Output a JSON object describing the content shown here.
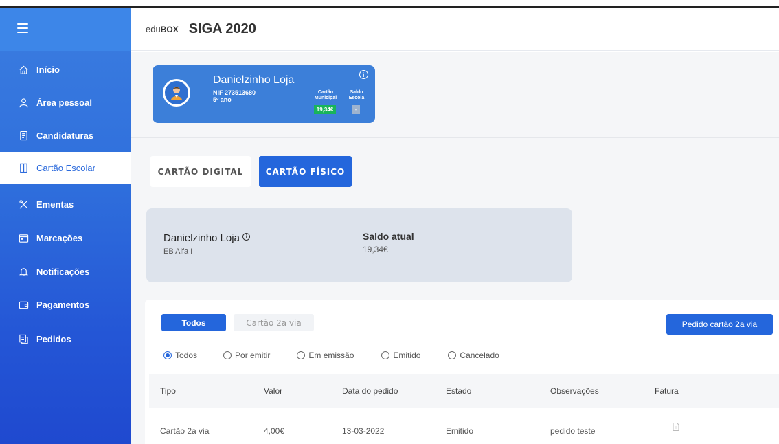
{
  "header": {
    "logo_text": "edu",
    "logo_box": "BOX",
    "title": "SIGA 2020"
  },
  "sidebar": {
    "items": [
      {
        "label": "Início",
        "icon": "home-icon"
      },
      {
        "label": "Área pessoal",
        "icon": "user-icon"
      },
      {
        "label": "Candidaturas",
        "icon": "document-icon"
      },
      {
        "label": "Cartão Escolar",
        "icon": "card-icon",
        "active": true
      },
      {
        "label": "Ementas",
        "icon": "cutlery-icon"
      },
      {
        "label": "Marcações",
        "icon": "calendar-icon"
      },
      {
        "label": "Notificações",
        "icon": "bell-icon"
      },
      {
        "label": "Pagamentos",
        "icon": "wallet-icon"
      },
      {
        "label": "Pedidos",
        "icon": "receipt-icon"
      }
    ]
  },
  "student": {
    "name": "Danielzinho Loja",
    "nif": "NIF 273513680",
    "year": "5º ano",
    "info": "i",
    "col1_label": "Cartão Municipal",
    "col2_label": "Saldo Escola",
    "municipal_balance": "19,34€",
    "school_balance": "-"
  },
  "tabs": {
    "digital": "CARTÃO DIGITAL",
    "fisico": "CARTÃO FÍSICO"
  },
  "balance": {
    "name": "Danielzinho Loja",
    "school": "EB Alfa I",
    "label": "Saldo atual",
    "value": "19,34€"
  },
  "requests": {
    "filter_all": "Todos",
    "filter_2via": "Cartão 2a via",
    "new_button": "Pedido cartão 2a via",
    "radios": [
      "Todos",
      "Por emitir",
      "Em emissão",
      "Emitido",
      "Cancelado"
    ],
    "columns": [
      "Tipo",
      "Valor",
      "Data do pedido",
      "Estado",
      "Observações",
      "Fatura"
    ],
    "rows": [
      {
        "tipo": "Cartão 2a via",
        "valor": "4,00€",
        "data": "13-03-2022",
        "estado": "Emitido",
        "obs": "pedido teste"
      }
    ]
  },
  "colors": {
    "primary": "#2466dc",
    "sidebar_top": "#3d86e8",
    "success": "#19b45a"
  }
}
